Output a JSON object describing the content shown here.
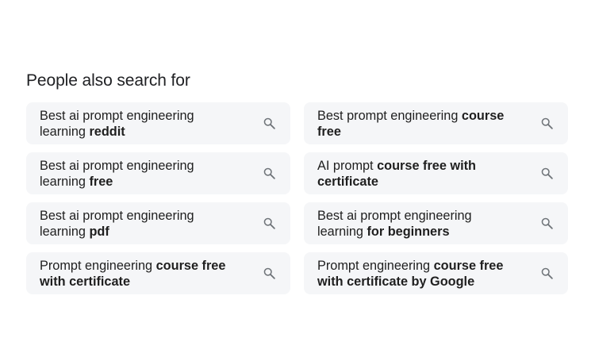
{
  "heading": "People also search for",
  "items": [
    {
      "plain": "Best ai prompt engineering learning ",
      "bold": "reddit"
    },
    {
      "plain": "Best prompt engineering ",
      "bold": "course free"
    },
    {
      "plain": "Best ai prompt engineering learning ",
      "bold": "free"
    },
    {
      "plain": "AI prompt ",
      "bold": "course free with certificate"
    },
    {
      "plain": "Best ai prompt engineering learning ",
      "bold": "pdf"
    },
    {
      "plain": "Best ai prompt engineering learning ",
      "bold": "for beginners"
    },
    {
      "plain": "Prompt engineering ",
      "bold": "course free with certificate"
    },
    {
      "plain": "Prompt engineering ",
      "bold": "course free with certificate by Google"
    }
  ],
  "icon": "search-icon"
}
